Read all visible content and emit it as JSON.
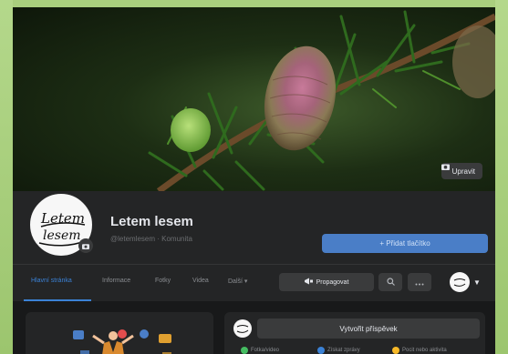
{
  "cover": {
    "edit_label": "Upravit"
  },
  "page": {
    "avatar_text_line1": "Letem",
    "avatar_text_line2": "lesem",
    "name": "Letem lesem",
    "subtitle": "@letemlesem · Komunita",
    "add_button": "+ Přidat tlačítko"
  },
  "tabs": {
    "items": [
      {
        "label": "Hlavní stránka"
      },
      {
        "label": "Informace"
      },
      {
        "label": "Fotky"
      },
      {
        "label": "Videa"
      },
      {
        "label": "Další ▾"
      }
    ],
    "promote_label": "Propagovat"
  },
  "composer": {
    "create_post": "Vytvořit příspěvek",
    "actions": [
      {
        "label": "Fotka/video",
        "color": "#45bd62"
      },
      {
        "label": "Získat zprávy",
        "color": "#3b82d6"
      },
      {
        "label": "Pocit nebo aktivita",
        "color": "#f7b928"
      }
    ]
  },
  "colors": {
    "accent": "#3b82d6",
    "add_button": "#4a7ec7",
    "surface": "#242526"
  }
}
